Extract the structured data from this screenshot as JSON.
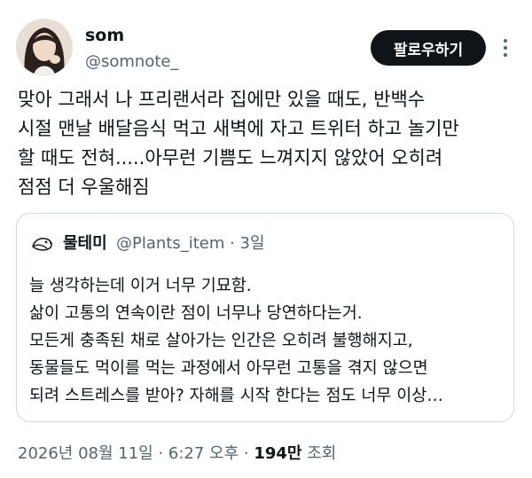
{
  "author": {
    "display_name": "som",
    "handle": "@somnote_"
  },
  "follow_button": {
    "label": "팔로우하기"
  },
  "tweet": {
    "lines": [
      "맞아 그래서 나 프리랜서라 집에만 있을 때도, 반백수",
      "시절 맨날 배달음식 먹고 새벽에 자고 트위터 하고 놀기만",
      "할 때도 전혀.....아무런 기쁨도 느껴지지 않았어 오히려",
      "점점 더 우울해짐"
    ]
  },
  "quoted_tweet": {
    "display_name": "물테미",
    "handle_time": "@Plants_item · 3일",
    "lines": [
      "늘 생각하는데 이거 너무 기묘함.",
      "삶이 고통의 연속이란 점이 너무나 당연하다는거.",
      "모든게 충족된 채로 살아가는 인간은 오히려 불행해지고,",
      "동물들도 먹이를 먹는 과정에서 아무런 고통을 겪지 않으면",
      "되려 스트레스를 받아? 자해를 시작 한다는 점도 너무 이상…"
    ]
  },
  "meta": {
    "datetime": "2026년 08월 11일 · 6:27 오후 · ",
    "views_count": "194만",
    "views_label": " 조회"
  },
  "icons": {
    "more": "more-horizontal-icon"
  }
}
